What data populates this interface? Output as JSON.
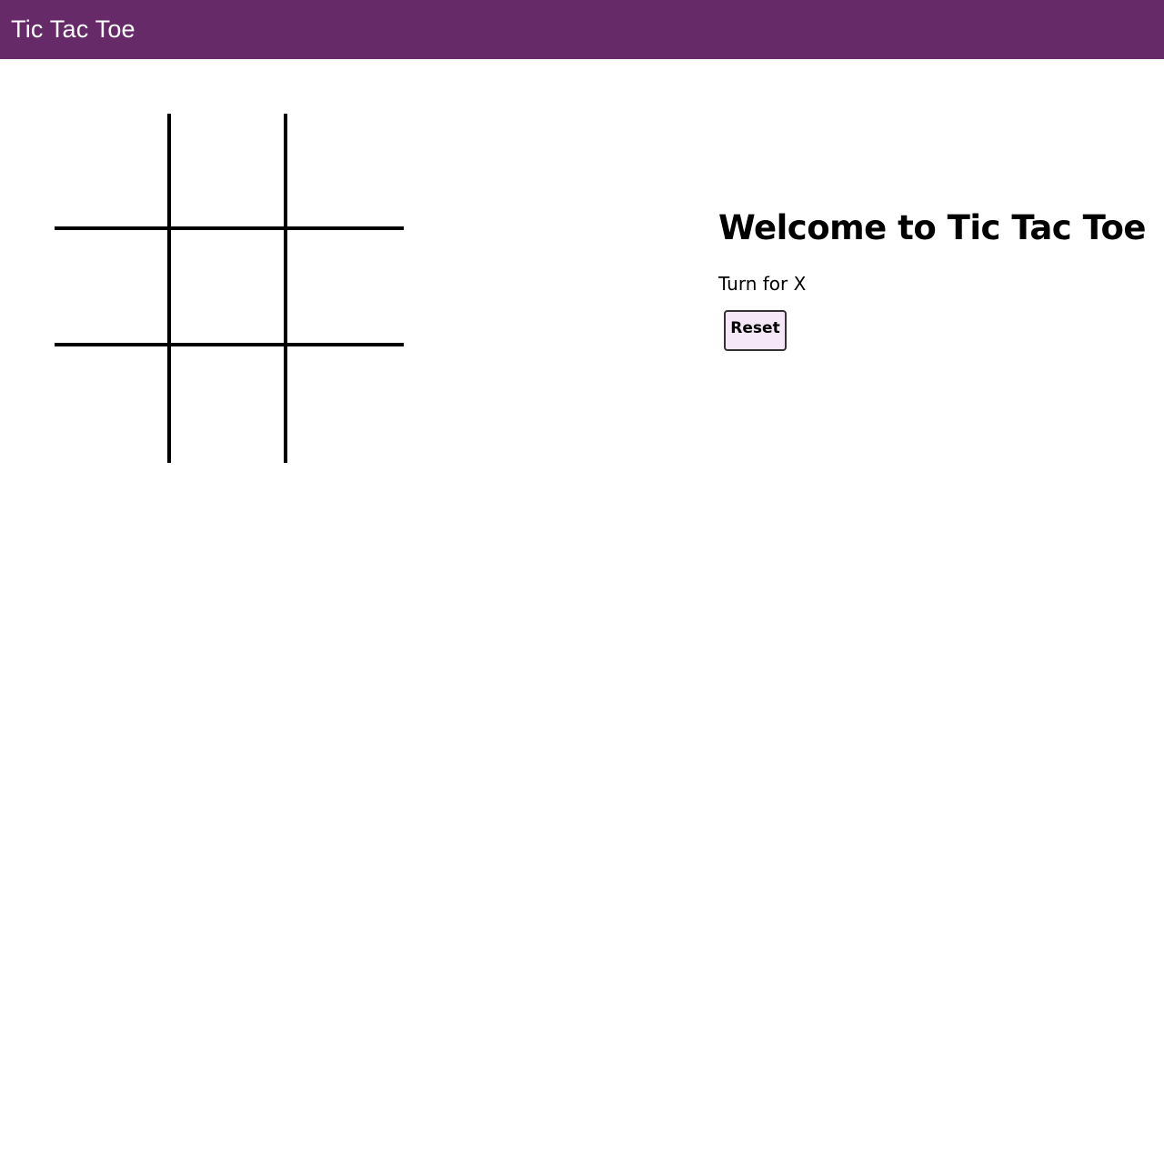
{
  "app": {
    "title": "Tic Tac Toe",
    "accent_color": "#672a68"
  },
  "board": {
    "cells": [
      "",
      "",
      "",
      "",
      "",
      "",
      "",
      "",
      ""
    ]
  },
  "panel": {
    "heading": "Welcome to Tic Tac Toe",
    "status": "Turn for X",
    "reset_label": "Reset",
    "reset_bg": "#f5e6f8"
  }
}
